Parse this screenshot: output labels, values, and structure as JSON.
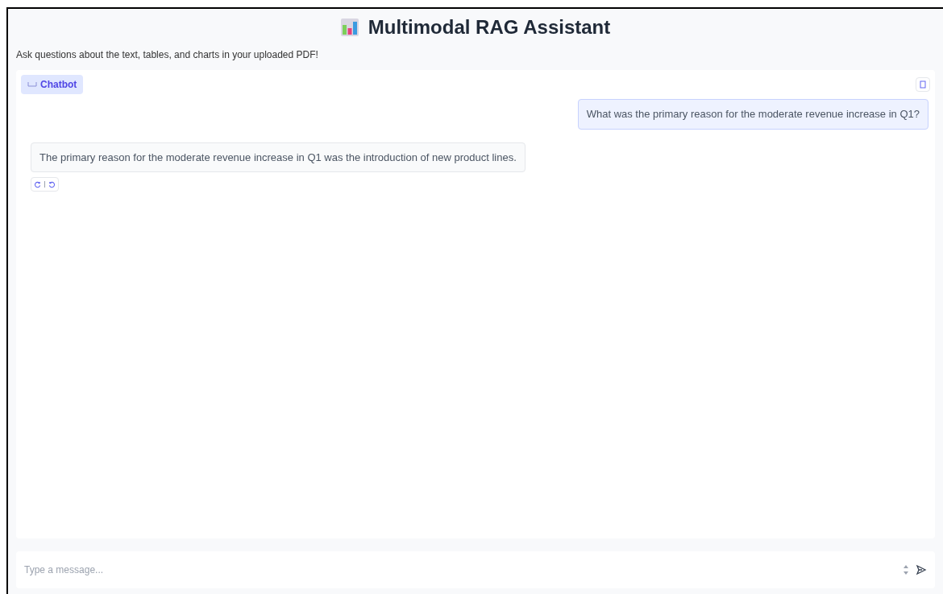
{
  "title": "Multimodal RAG Assistant",
  "subtitle": "Ask questions about the text, tables, and charts in your uploaded PDF!",
  "chatbot": {
    "label": "Chatbot",
    "messages": [
      {
        "kind": "user",
        "text": "What was the primary reason for the moderate revenue increase in Q1?"
      },
      {
        "kind": "bot",
        "text": "The primary reason for the moderate revenue increase in Q1 was the introduction of new product lines."
      }
    ]
  },
  "input": {
    "placeholder": "Type a message..."
  }
}
